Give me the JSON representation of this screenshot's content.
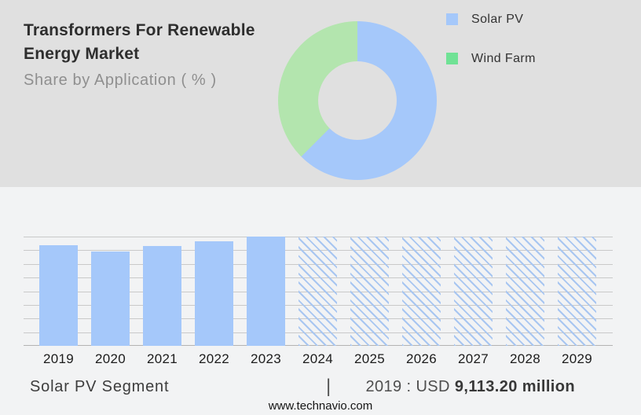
{
  "header": {
    "title_line1": "Transformers For Renewable",
    "title_line2": "Energy Market",
    "subtitle": "Share by Application ( % )"
  },
  "legend": {
    "items": [
      {
        "label": "Solar PV",
        "color": "#a5c8fa"
      },
      {
        "label": "Wind Farm",
        "color": "#70e295"
      }
    ]
  },
  "caption": {
    "segment_label": "Solar PV Segment",
    "separator": "|",
    "value_prefix": "2019 : USD ",
    "value_bold": "9,113.20 million"
  },
  "footer": {
    "url": "www.technavio.com"
  },
  "colors": {
    "band_top_bg": "#e0e0e0",
    "band_bottom_bg": "#f2f3f4",
    "bar_blue": "#a5c8fa",
    "pie_green": "#b3e5ae",
    "legend_green": "#70e295",
    "gridline": "#c9c9c9",
    "axis_line": "#b3b3b3"
  },
  "chart_data": [
    {
      "type": "pie",
      "subtype": "donut",
      "title": "Share by Application ( % )",
      "labels": [
        "Solar PV",
        "Wind Farm"
      ],
      "values_pct": [
        62.5,
        37.5
      ],
      "colors": [
        "#a5c8fa",
        "#b3e5ae"
      ],
      "legend_position": "right",
      "start_angle_deg": 0,
      "direction": "clockwise"
    },
    {
      "type": "bar",
      "title": "",
      "xlabel": "",
      "ylabel": "",
      "categories": [
        "2019",
        "2020",
        "2021",
        "2022",
        "2023",
        "2024",
        "2025",
        "2026",
        "2027",
        "2028",
        "2029"
      ],
      "values_relative": [
        0.92,
        0.863,
        0.914,
        0.957,
        1.0,
        1.0,
        1.0,
        1.0,
        1.0,
        1.0,
        1.0
      ],
      "historical_categories": [
        "2019",
        "2020",
        "2021",
        "2022",
        "2023"
      ],
      "forecast_categories": [
        "2024",
        "2025",
        "2026",
        "2027",
        "2028",
        "2029"
      ],
      "forecast_style": "hatched",
      "bar_color": "#a5c8fa",
      "hatch_color": "#a8c6f1",
      "grid": true,
      "gridline_count": 9,
      "known_point": "2019 : USD 9,113.20 million"
    }
  ]
}
